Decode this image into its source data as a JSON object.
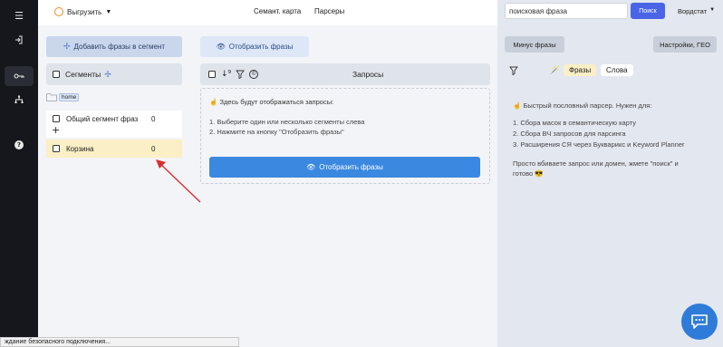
{
  "topbar": {
    "export_label": "Выгрузить",
    "nav": [
      "Семант. карта",
      "Парсеры"
    ]
  },
  "search": {
    "value": "поисковая фраза",
    "button_label": "Поиск",
    "source_label": "Вордстат"
  },
  "segments": {
    "add_button_label": "Добавить фразы в сегмент",
    "header_label": "Сегменты",
    "folder_label": "home",
    "items": [
      {
        "label": "Общий сегмент фраз",
        "count": "0"
      },
      {
        "label": "Корзина",
        "count": "0"
      }
    ]
  },
  "queries": {
    "show_button_top_label": "Отобразить фразы",
    "header_label": "Запросы",
    "hint_title": "Здесь будут отображаться запросы:",
    "hint_steps": [
      "1. Выберите один или несколько сегменты слева",
      "2. Нажмите на кнопку \"Отобразить фразы\""
    ],
    "show_button_label": "Отобразить фразы"
  },
  "right": {
    "minus_label": "Минус фразы",
    "settings_label": "Настройки, ГЕО",
    "tab_phrases": "Фразы",
    "tab_words": "Слова",
    "intro": "Быстрый пословный парсер. Нужен для:",
    "list": [
      "1. Сбора масок в семантическую карту",
      "2. Сбора ВЧ запросов для парсинга",
      "3. Расширения СЯ через Букварикс и Keyword Planner"
    ],
    "outro_line1": "Просто вбиваете запрос или домен, жмете \"поиск\" и",
    "outro_line2": "готово"
  },
  "status": {
    "text": "ждание безопасного подключения..."
  },
  "colors": {
    "accent": "#4a64e6",
    "primary_button": "#3b88e0",
    "highlight": "#fbefc6",
    "sidebar": "#15171d",
    "arrow": "#d92f2f"
  }
}
